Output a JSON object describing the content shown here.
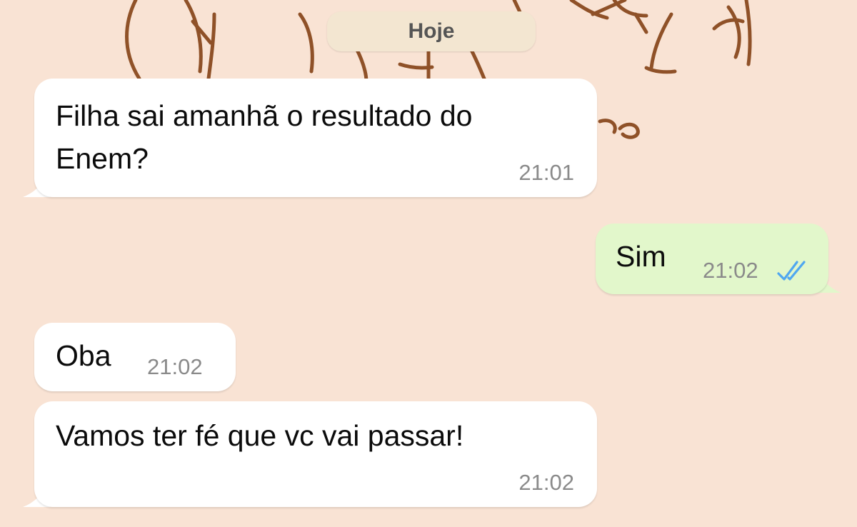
{
  "date_separator": {
    "label": "Hoje"
  },
  "messages": [
    {
      "direction": "incoming",
      "text": "Filha sai amanhã o resultado do\nEnem?",
      "time": "21:01"
    },
    {
      "direction": "outgoing",
      "text": "Sim",
      "time": "21:02",
      "status_icon": "double-check-read-icon",
      "status_color": "#4fa7f0"
    },
    {
      "direction": "incoming",
      "text": "Oba",
      "time": "21:02"
    },
    {
      "direction": "incoming",
      "text": "Vamos ter fé que vc vai passar!",
      "time": "21:02"
    }
  ],
  "colors": {
    "wallpaper": "#f9e3d4",
    "doodle": "#8a4a1f",
    "incoming_bubble": "#ffffff",
    "outgoing_bubble": "#e2f7cb"
  }
}
